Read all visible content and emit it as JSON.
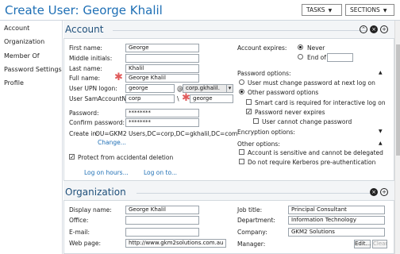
{
  "header": {
    "title": "Create User: George Khalil",
    "tasks_label": "TASKS",
    "sections_label": "SECTIONS"
  },
  "nav": {
    "items": [
      "Account",
      "Organization",
      "Member Of",
      "Password Settings",
      "Profile"
    ]
  },
  "account": {
    "heading": "Account",
    "first_name_label": "First name:",
    "first_name": "George",
    "middle_initials_label": "Middle initials:",
    "middle_initials": "",
    "last_name_label": "Last name:",
    "last_name": "Khalil",
    "full_name_label": "Full name:",
    "full_name": "George Khalil",
    "upn_label": "User UPN logon:",
    "upn_user": "george",
    "upn_at": "@",
    "upn_domain": "corp.gkhalil.",
    "sam_label": "User SamAccountN...",
    "sam_domain": "corp",
    "sam_sep": "\\",
    "sam_user": "george",
    "password_label": "Password:",
    "password": "********",
    "confirm_label": "Confirm password:",
    "confirm": "********",
    "create_in_label": "Create in:",
    "create_in_value": "OU=GKM2 Users,DC=corp,DC=gkhalil,DC=com",
    "change_link": "Change...",
    "protect_label": "Protect from accidental deletion",
    "logon_hours_link": "Log on hours...",
    "logon_to_link": "Log on to...",
    "expires_label": "Account expires:",
    "never_label": "Never",
    "end_of_label": "End of",
    "end_of_value": "",
    "pwd_options_label": "Password options:",
    "must_change_label": "User must change password at next log on",
    "other_pwd_label": "Other password options",
    "smart_card_label": "Smart card is required for interactive log on",
    "never_expires_label": "Password never expires",
    "cannot_change_label": "User cannot change password",
    "encryption_label": "Encryption options:",
    "other_options_label": "Other options:",
    "sensitive_label": "Account is sensitive and cannot be delegated",
    "kerberos_label": "Do not require Kerberos pre-authentication",
    "req_mark": "✱",
    "checkmark": "✓"
  },
  "organization": {
    "heading": "Organization",
    "display_name_label": "Display name:",
    "display_name": "George Khalil",
    "office_label": "Office:",
    "office": "",
    "email_label": "E-mail:",
    "email": "",
    "web_label": "Web page:",
    "web": "http://www.gkm2solutions.com.au",
    "job_title_label": "Job title:",
    "job_title": "Principal Consultant",
    "department_label": "Department:",
    "department": "Information Technology",
    "company_label": "Company:",
    "company": "GKM2 Solutions",
    "manager_label": "Manager:",
    "edit_label": "Edit...",
    "clear_label": "Clear"
  },
  "icons": {
    "collapse": "⌃",
    "close": "×",
    "add": "+",
    "dropdown": "▾",
    "expand_down": "▼",
    "expand_up": "▲"
  }
}
